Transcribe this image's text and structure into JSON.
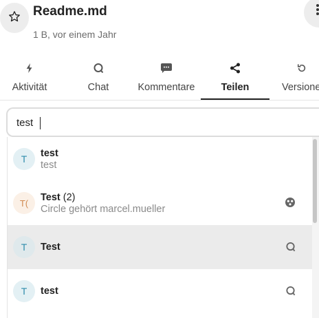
{
  "file": {
    "name": "Readme.md",
    "meta": "1 B, vor einem Jahr"
  },
  "tabs": [
    {
      "label": "Aktivität",
      "icon": "flash-icon"
    },
    {
      "label": "Chat",
      "icon": "chat-bubble-icon"
    },
    {
      "label": "Kommentare",
      "icon": "comment-icon"
    },
    {
      "label": "Teilen",
      "icon": "share-icon",
      "active": true
    },
    {
      "label": "Versionen",
      "icon": "history-icon"
    }
  ],
  "search": {
    "value": "test"
  },
  "results": [
    {
      "avatar": "T",
      "name": "test",
      "sub": "test",
      "icon": ""
    },
    {
      "avatar": "T(",
      "name": "Test",
      "count": "(2)",
      "sub": "Circle gehört marcel.mueller",
      "icon": "circles-icon"
    },
    {
      "avatar": "T",
      "name": "Test",
      "icon": "chat-bubble-icon",
      "highlighted": true
    },
    {
      "avatar": "T",
      "name": "test",
      "icon": "chat-bubble-icon"
    }
  ],
  "colors": {
    "accent": "#222222",
    "avatar_blue": "#2e8cab",
    "avatar_peach": "#d08a50",
    "highlight": "#ebebeb"
  }
}
